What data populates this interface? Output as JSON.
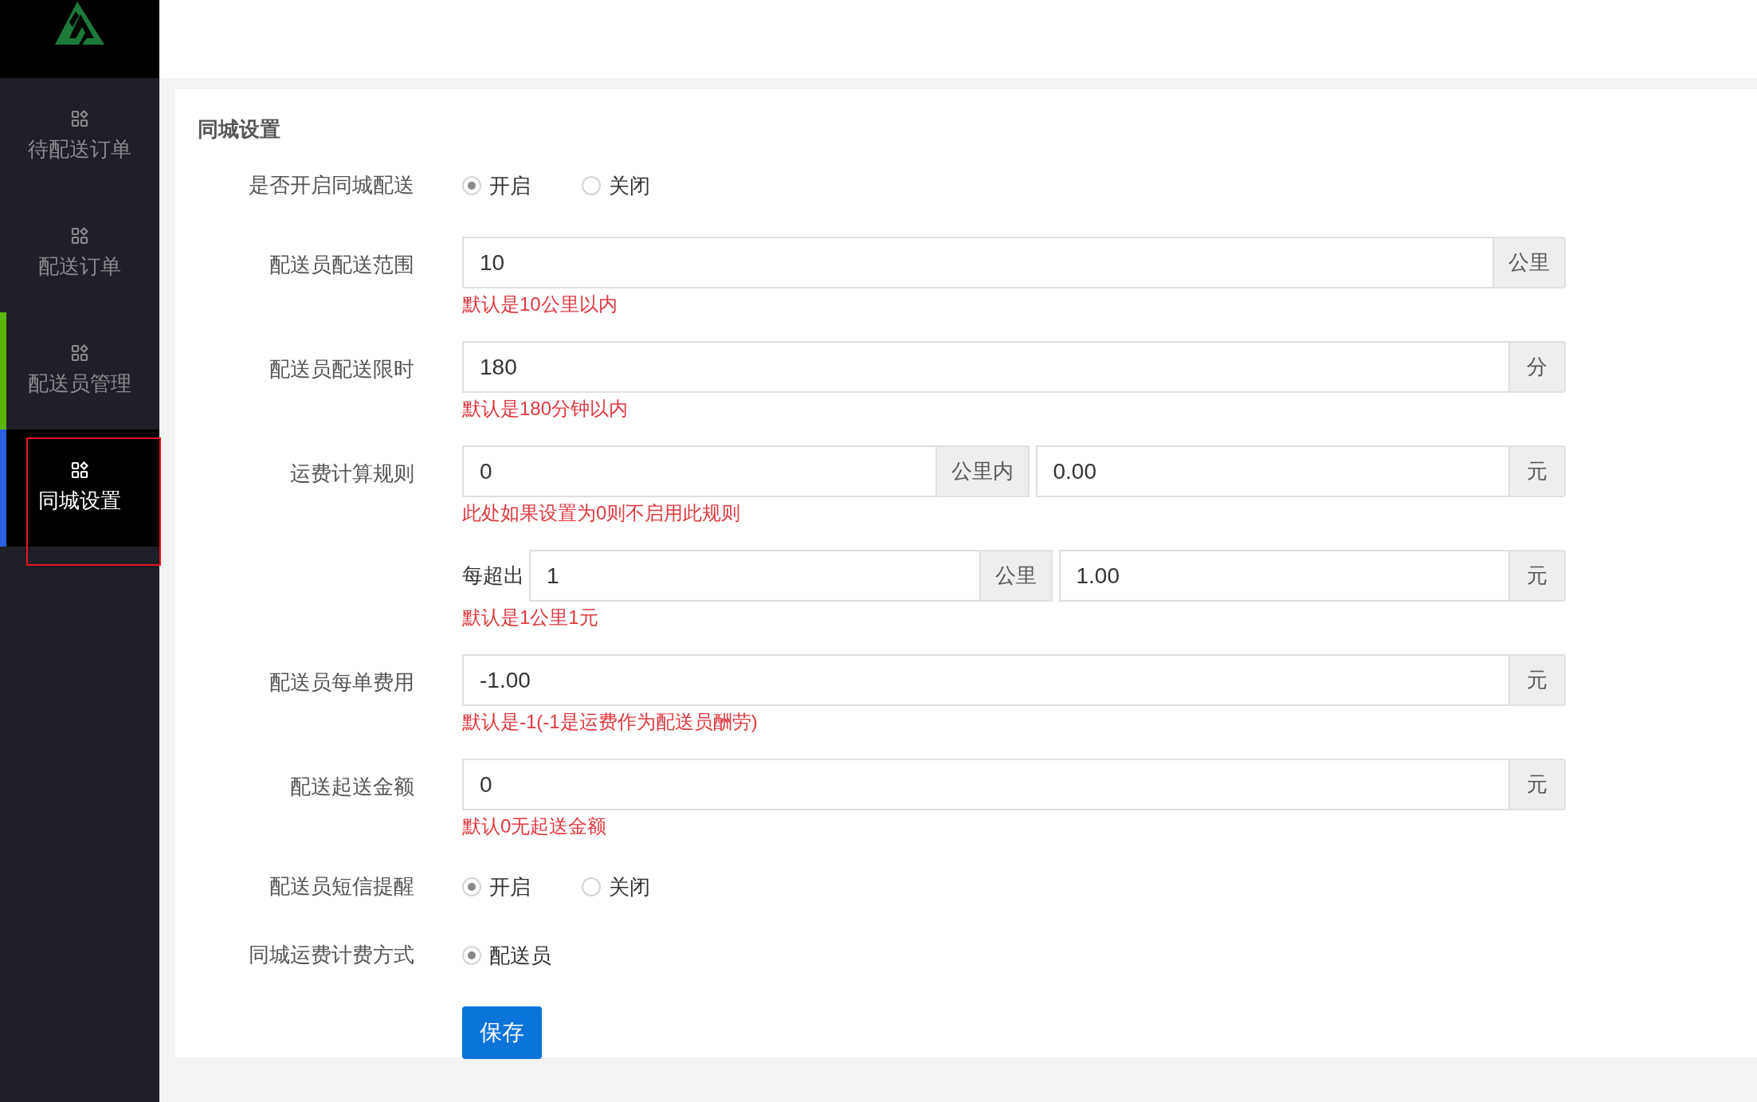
{
  "sidebar": {
    "items": [
      {
        "label": "待配送订单",
        "selected": false,
        "hovered": false,
        "highlighted": false
      },
      {
        "label": "配送订单",
        "selected": false,
        "hovered": false,
        "highlighted": false
      },
      {
        "label": "配送员管理",
        "selected": false,
        "hovered": true,
        "highlighted": false
      },
      {
        "label": "同城设置",
        "selected": true,
        "hovered": false,
        "highlighted": true
      }
    ]
  },
  "form": {
    "title": "同城设置",
    "rows": [
      {
        "kind": "radio",
        "label": "是否开启同城配送",
        "options": [
          {
            "label": "开启",
            "selected": true
          },
          {
            "label": "关闭",
            "selected": false
          }
        ]
      },
      {
        "kind": "input",
        "label": "配送员配送范围",
        "value": "10",
        "addon": "公里",
        "help": "默认是10公里以内"
      },
      {
        "kind": "input",
        "label": "配送员配送限时",
        "value": "180",
        "addon": "分",
        "help": "默认是180分钟以内"
      },
      {
        "kind": "pair",
        "label": "运费计算规则",
        "value": "0",
        "addon": "公里内",
        "value2": "0.00",
        "addon2": "元",
        "help": "此处如果设置为0则不启用此规则"
      },
      {
        "kind": "pair",
        "prefix": "每超出",
        "value": "1",
        "addon": "公里",
        "value2": "1.00",
        "addon2": "元",
        "help": "默认是1公里1元"
      },
      {
        "kind": "input",
        "label": "配送员每单费用",
        "value": "-1.00",
        "addon": "元",
        "help": "默认是-1(-1是运费作为配送员酬劳)"
      },
      {
        "kind": "input",
        "label": "配送起送金额",
        "value": "0",
        "addon": "元",
        "help": "默认0无起送金额"
      },
      {
        "kind": "radio",
        "label": "配送员短信提醒",
        "options": [
          {
            "label": "开启",
            "selected": true
          },
          {
            "label": "关闭",
            "selected": false
          }
        ]
      },
      {
        "kind": "radio",
        "label": "同城运费计费方式",
        "options": [
          {
            "label": "配送员",
            "selected": true
          }
        ]
      }
    ],
    "save_button": "保存"
  }
}
